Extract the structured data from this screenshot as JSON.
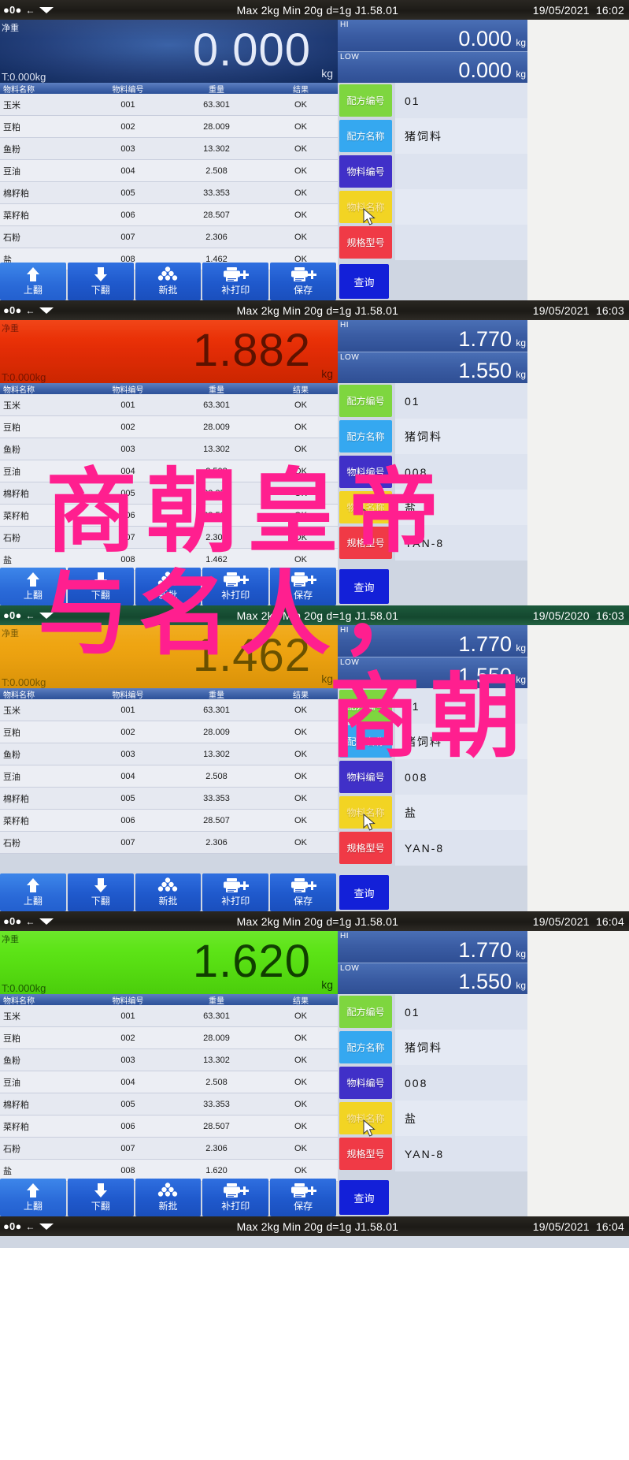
{
  "meta": {
    "net_label": "净重",
    "tare_label": "T:0.000kg",
    "kg": "kg",
    "hi_tag": "HI",
    "low_tag": "LOW"
  },
  "table": {
    "headers": [
      "物料名称",
      "物料编号",
      "重量",
      "结果"
    ]
  },
  "fields_labels": {
    "recipe_no": "配方编号",
    "recipe_name": "配方名称",
    "material_no": "物料编号",
    "material_name": "物料名称",
    "spec_model": "规格型号"
  },
  "buttons": {
    "page_up": "上翻",
    "page_down": "下翻",
    "new_batch": "新批",
    "reprint": "补打印",
    "save": "保存",
    "query": "查询"
  },
  "icons": {
    "zero": "0",
    "arrow_left": "←",
    "page_up": "arrow-up-icon",
    "page_down": "arrow-down-icon",
    "new_batch": "stack-icon",
    "reprint": "printer-plus-icon",
    "save": "printer-plus-icon",
    "stable": "stable-triangle-icon"
  },
  "colors": {
    "key_green": "#7ed63f",
    "key_blue": "#35a8f0",
    "key_indigo": "#4030c8",
    "key_yellow": "#f2d423",
    "key_red": "#f03a46",
    "query_blue": "#1320d8",
    "display_blue": "#24407c",
    "display_red": "#e62d06",
    "display_orange": "#eea310",
    "display_green": "#59e213",
    "overlay_pink": "#ff1f8f"
  },
  "overlay_text": [
    "商朝皇帝",
    "与名人，",
    "商朝"
  ],
  "panels": [
    {
      "statusbar": {
        "spec": "Max 2kg  Min 20g  d=1g    J1.58.01",
        "date": "19/05/2021",
        "time": "16:02",
        "theme": "dark"
      },
      "display": {
        "value": "0.000",
        "unit": "kg",
        "theme": "blue"
      },
      "limits": {
        "hi": "0.000",
        "low": "0.000",
        "unit": "kg"
      },
      "fields": {
        "recipe_no": "01",
        "recipe_name": "猪饲料",
        "material_no": "",
        "material_name": "",
        "spec_model": ""
      },
      "highlight_key": "material_name",
      "rows": [
        {
          "name": "玉米",
          "code": "001",
          "weight": "63.301",
          "result": "OK"
        },
        {
          "name": "豆粕",
          "code": "002",
          "weight": "28.009",
          "result": "OK"
        },
        {
          "name": "鱼粉",
          "code": "003",
          "weight": "13.302",
          "result": "OK"
        },
        {
          "name": "豆油",
          "code": "004",
          "weight": "2.508",
          "result": "OK"
        },
        {
          "name": "棉籽粕",
          "code": "005",
          "weight": "33.353",
          "result": "OK"
        },
        {
          "name": "菜籽粕",
          "code": "006",
          "weight": "28.507",
          "result": "OK"
        },
        {
          "name": "石粉",
          "code": "007",
          "weight": "2.306",
          "result": "OK"
        },
        {
          "name": "盐",
          "code": "008",
          "weight": "1.462",
          "result": "OK"
        }
      ]
    },
    {
      "statusbar": {
        "spec": "Max 2kg  Min 20g  d=1g    J1.58.01",
        "date": "19/05/2021",
        "time": "16:03",
        "theme": "dark"
      },
      "display": {
        "value": "1.882",
        "unit": "kg",
        "theme": "red"
      },
      "limits": {
        "hi": "1.770",
        "low": "1.550",
        "unit": "kg"
      },
      "fields": {
        "recipe_no": "01",
        "recipe_name": "猪饲料",
        "material_no": "008",
        "material_name": "盐",
        "spec_model": "YAN-8"
      },
      "highlight_key": "material_name",
      "rows": [
        {
          "name": "玉米",
          "code": "001",
          "weight": "63.301",
          "result": "OK"
        },
        {
          "name": "豆粕",
          "code": "002",
          "weight": "28.009",
          "result": "OK"
        },
        {
          "name": "鱼粉",
          "code": "003",
          "weight": "13.302",
          "result": "OK"
        },
        {
          "name": "豆油",
          "code": "004",
          "weight": "2.508",
          "result": "OK"
        },
        {
          "name": "棉籽粕",
          "code": "005",
          "weight": "33.353",
          "result": "OK"
        },
        {
          "name": "菜籽粕",
          "code": "006",
          "weight": "28.507",
          "result": "OK"
        },
        {
          "name": "石粉",
          "code": "007",
          "weight": "2.306",
          "result": "OK"
        },
        {
          "name": "盐",
          "code": "008",
          "weight": "1.462",
          "result": "OK"
        }
      ]
    },
    {
      "statusbar": {
        "spec": "Max 2kg  Min 20g  d=1g    J1.58.01",
        "date": "19/05/2020",
        "time": "16:03",
        "theme": "green"
      },
      "display": {
        "value": "1.462",
        "unit": "kg",
        "theme": "orange"
      },
      "limits": {
        "hi": "1.770",
        "low": "1.550",
        "unit": "kg"
      },
      "fields": {
        "recipe_no": "01",
        "recipe_name": "猪饲料",
        "material_no": "008",
        "material_name": "盐",
        "spec_model": "YAN-8"
      },
      "highlight_key": "material_name",
      "rows": [
        {
          "name": "玉米",
          "code": "001",
          "weight": "63.301",
          "result": "OK"
        },
        {
          "name": "豆粕",
          "code": "002",
          "weight": "28.009",
          "result": "OK"
        },
        {
          "name": "鱼粉",
          "code": "003",
          "weight": "13.302",
          "result": "OK"
        },
        {
          "name": "豆油",
          "code": "004",
          "weight": "2.508",
          "result": "OK"
        },
        {
          "name": "棉籽粕",
          "code": "005",
          "weight": "33.353",
          "result": "OK"
        },
        {
          "name": "菜籽粕",
          "code": "006",
          "weight": "28.507",
          "result": "OK"
        },
        {
          "name": "石粉",
          "code": "007",
          "weight": "2.306",
          "result": "OK"
        }
      ]
    },
    {
      "statusbar": {
        "spec": "Max 2kg  Min 20g  d=1g    J1.58.01",
        "date": "19/05/2021",
        "time": "16:04",
        "theme": "dark"
      },
      "display": {
        "value": "1.620",
        "unit": "kg",
        "theme": "green"
      },
      "limits": {
        "hi": "1.770",
        "low": "1.550",
        "unit": "kg"
      },
      "fields": {
        "recipe_no": "01",
        "recipe_name": "猪饲料",
        "material_no": "008",
        "material_name": "盐",
        "spec_model": "YAN-8"
      },
      "highlight_key": "material_name",
      "rows": [
        {
          "name": "玉米",
          "code": "001",
          "weight": "63.301",
          "result": "OK"
        },
        {
          "name": "豆粕",
          "code": "002",
          "weight": "28.009",
          "result": "OK"
        },
        {
          "name": "鱼粉",
          "code": "003",
          "weight": "13.302",
          "result": "OK"
        },
        {
          "name": "豆油",
          "code": "004",
          "weight": "2.508",
          "result": "OK"
        },
        {
          "name": "棉籽粕",
          "code": "005",
          "weight": "33.353",
          "result": "OK"
        },
        {
          "name": "菜籽粕",
          "code": "006",
          "weight": "28.507",
          "result": "OK"
        },
        {
          "name": "石粉",
          "code": "007",
          "weight": "2.306",
          "result": "OK"
        },
        {
          "name": "盐",
          "code": "008",
          "weight": "1.620",
          "result": "OK"
        }
      ]
    },
    {
      "statusbar": {
        "spec": "Max 2kg  Min 20g  d=1g    J1.58.01",
        "date": "19/05/2021",
        "time": "16:04",
        "theme": "dark"
      },
      "display": null,
      "limits": null,
      "fields": null,
      "rows": []
    }
  ]
}
